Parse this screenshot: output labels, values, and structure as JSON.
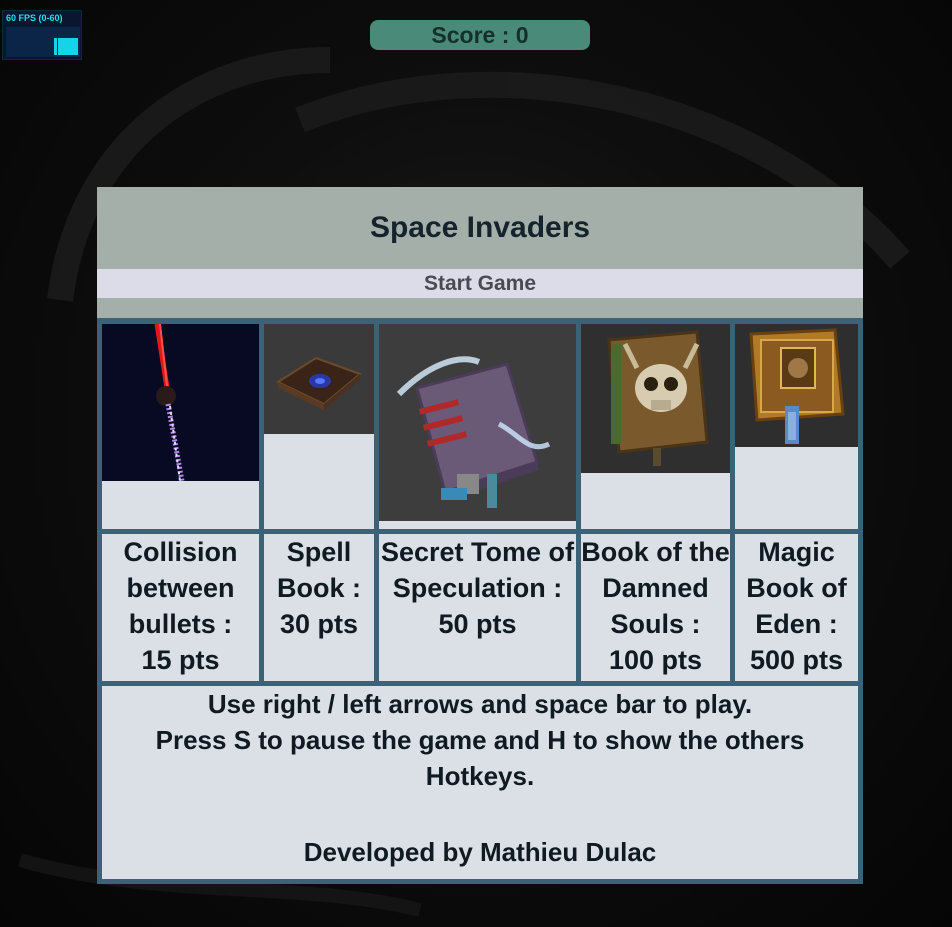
{
  "fps": {
    "label": "60 FPS (0-60)"
  },
  "hud": {
    "score": "Score : 0"
  },
  "menu": {
    "title": "Space Invaders",
    "start_label": "Start Game",
    "enemies": [
      {
        "name": "collision",
        "text": [
          "Collision",
          "between",
          "bullets :",
          "15 pts"
        ],
        "icon": "bullet-collision-icon"
      },
      {
        "name": "spell-book",
        "text": [
          "Spell",
          "Book :",
          "30 pts"
        ],
        "icon": "spell-book-icon"
      },
      {
        "name": "secret-tome",
        "text": [
          "Secret Tome of",
          "Speculation :",
          "50 pts"
        ],
        "icon": "secret-tome-icon"
      },
      {
        "name": "damned-souls",
        "text": [
          "Book of the",
          "Damned",
          "Souls :",
          "100 pts"
        ],
        "icon": "damned-souls-book-icon"
      },
      {
        "name": "magic-eden",
        "text": [
          "Magic",
          "Book of",
          "Eden :",
          "500 pts"
        ],
        "icon": "magic-eden-book-icon"
      }
    ],
    "instructions": [
      "Use right / left arrows and space bar to play.",
      "Press S to pause the game and H to show the others Hotkeys."
    ],
    "credit": "Developed by Mathieu Dulac"
  }
}
